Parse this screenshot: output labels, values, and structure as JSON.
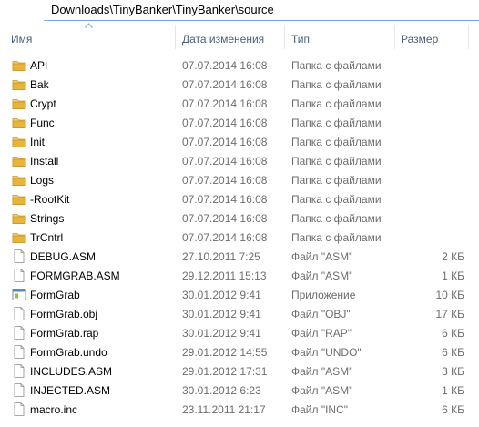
{
  "address_bar": {
    "path": "Downloads\\TinyBanker\\TinyBanker\\source"
  },
  "columns": {
    "name": "Имя",
    "date": "Дата изменения",
    "type": "Тип",
    "size": "Размер"
  },
  "files": [
    {
      "name": "API",
      "date": "07.07.2014 16:08",
      "type": "Папка с файлами",
      "size": "",
      "icon": "folder-icon"
    },
    {
      "name": "Bak",
      "date": "07.07.2014 16:08",
      "type": "Папка с файлами",
      "size": "",
      "icon": "folder-icon"
    },
    {
      "name": "Crypt",
      "date": "07.07.2014 16:08",
      "type": "Папка с файлами",
      "size": "",
      "icon": "folder-icon"
    },
    {
      "name": "Func",
      "date": "07.07.2014 16:08",
      "type": "Папка с файлами",
      "size": "",
      "icon": "folder-icon"
    },
    {
      "name": "Init",
      "date": "07.07.2014 16:08",
      "type": "Папка с файлами",
      "size": "",
      "icon": "folder-icon"
    },
    {
      "name": "Install",
      "date": "07.07.2014 16:08",
      "type": "Папка с файлами",
      "size": "",
      "icon": "folder-icon"
    },
    {
      "name": "Logs",
      "date": "07.07.2014 16:08",
      "type": "Папка с файлами",
      "size": "",
      "icon": "folder-icon"
    },
    {
      "name": "-RootKit",
      "date": "07.07.2014 16:08",
      "type": "Папка с файлами",
      "size": "",
      "icon": "folder-icon"
    },
    {
      "name": "Strings",
      "date": "07.07.2014 16:08",
      "type": "Папка с файлами",
      "size": "",
      "icon": "folder-icon"
    },
    {
      "name": "TrCntrl",
      "date": "07.07.2014 16:08",
      "type": "Папка с файлами",
      "size": "",
      "icon": "folder-icon"
    },
    {
      "name": "DEBUG.ASM",
      "date": "27.10.2011 7:25",
      "type": "Файл \"ASM\"",
      "size": "2 КБ",
      "icon": "file-icon"
    },
    {
      "name": "FORMGRAB.ASM",
      "date": "29.12.2011 15:13",
      "type": "Файл \"ASM\"",
      "size": "1 КБ",
      "icon": "file-icon"
    },
    {
      "name": "FormGrab",
      "date": "30.01.2012 9:41",
      "type": "Приложение",
      "size": "10 КБ",
      "icon": "application-icon"
    },
    {
      "name": "FormGrab.obj",
      "date": "30.01.2012 9:41",
      "type": "Файл \"OBJ\"",
      "size": "17 КБ",
      "icon": "file-icon"
    },
    {
      "name": "FormGrab.rap",
      "date": "30.01.2012 9:41",
      "type": "Файл \"RAP\"",
      "size": "6 КБ",
      "icon": "file-icon"
    },
    {
      "name": "FormGrab.undo",
      "date": "29.01.2012 14:55",
      "type": "Файл \"UNDO\"",
      "size": "6 КБ",
      "icon": "file-icon"
    },
    {
      "name": "INCLUDES.ASM",
      "date": "29.01.2012 17:31",
      "type": "Файл \"ASM\"",
      "size": "3 КБ",
      "icon": "file-icon"
    },
    {
      "name": "INJECTED.ASM",
      "date": "30.01.2012 6:23",
      "type": "Файл \"ASM\"",
      "size": "1 КБ",
      "icon": "file-icon"
    },
    {
      "name": "macro.inc",
      "date": "23.11.2011 21:17",
      "type": "Файл \"INC\"",
      "size": "6 КБ",
      "icon": "file-icon"
    }
  ],
  "colors": {
    "folder": "#e8b53a",
    "header_text": "#4c607a",
    "meta_text": "#6d6d6d",
    "address_border": "#7aa7d8"
  }
}
